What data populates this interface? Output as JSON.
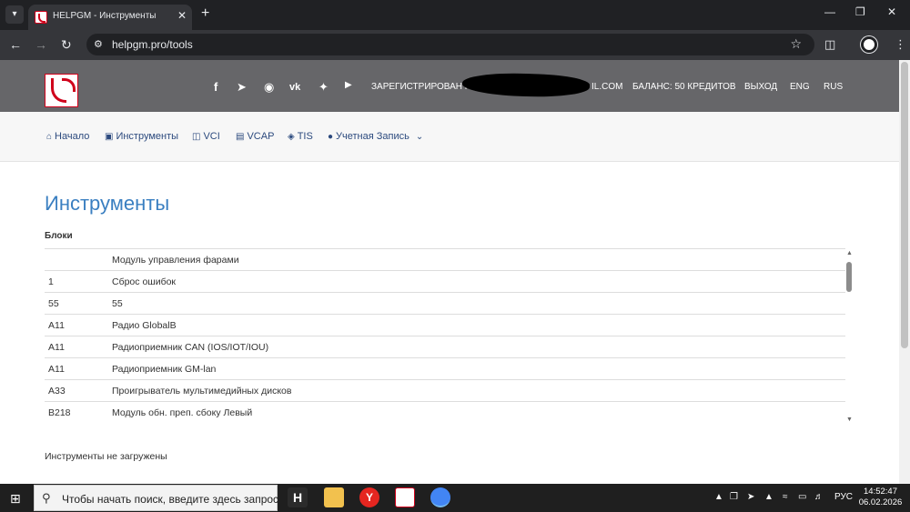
{
  "browser": {
    "tab_title": "HELPGM - Инструменты",
    "url": "helpgm.pro/tools"
  },
  "header": {
    "registered_text": "ЗАРЕГИСТРИРОВАН К",
    "registered_suffix": "IL.COM",
    "balance": "БАЛАНС: 50 КРЕДИТОВ",
    "logout": "ВЫХОД",
    "lang_eng": "ENG",
    "lang_rus": "RUS",
    "social_icons": [
      "facebook-icon",
      "telegram-icon",
      "instagram-icon",
      "vk-icon",
      "twitter-icon",
      "youtube-icon"
    ]
  },
  "nav": {
    "home": "Начало",
    "tools": "Инструменты",
    "vci": "VCI",
    "vcap": "VCAP",
    "tis": "TIS",
    "account": "Учетная Запись"
  },
  "main": {
    "title": "Инструменты",
    "section": "Блоки",
    "rows": [
      {
        "code": "",
        "name": "Модуль управления фарами"
      },
      {
        "code": "1",
        "name": "Сброс ошибок"
      },
      {
        "code": "55",
        "name": "55"
      },
      {
        "code": "A11",
        "name": "Радио GlobalB"
      },
      {
        "code": "A11",
        "name": "Радиоприемник CAN (IOS/IOT/IOU)"
      },
      {
        "code": "A11",
        "name": "Радиоприемник GM-lan"
      },
      {
        "code": "A33",
        "name": "Проигрыватель мультимедийных дисков"
      },
      {
        "code": "B218",
        "name": "Модуль обн. преп. сбоку Левый"
      }
    ],
    "status": "Инструменты не загружены"
  },
  "taskbar": {
    "search_placeholder": "Чтобы начать поиск, введите здесь запрос",
    "lang": "РУС",
    "time": "14:52:47",
    "date": "06.02.2026"
  },
  "colors": {
    "header_bg": "#666669",
    "title_blue": "#3a7fc1",
    "nav_link": "#2c4a7e",
    "brand_red": "#d0021b"
  }
}
